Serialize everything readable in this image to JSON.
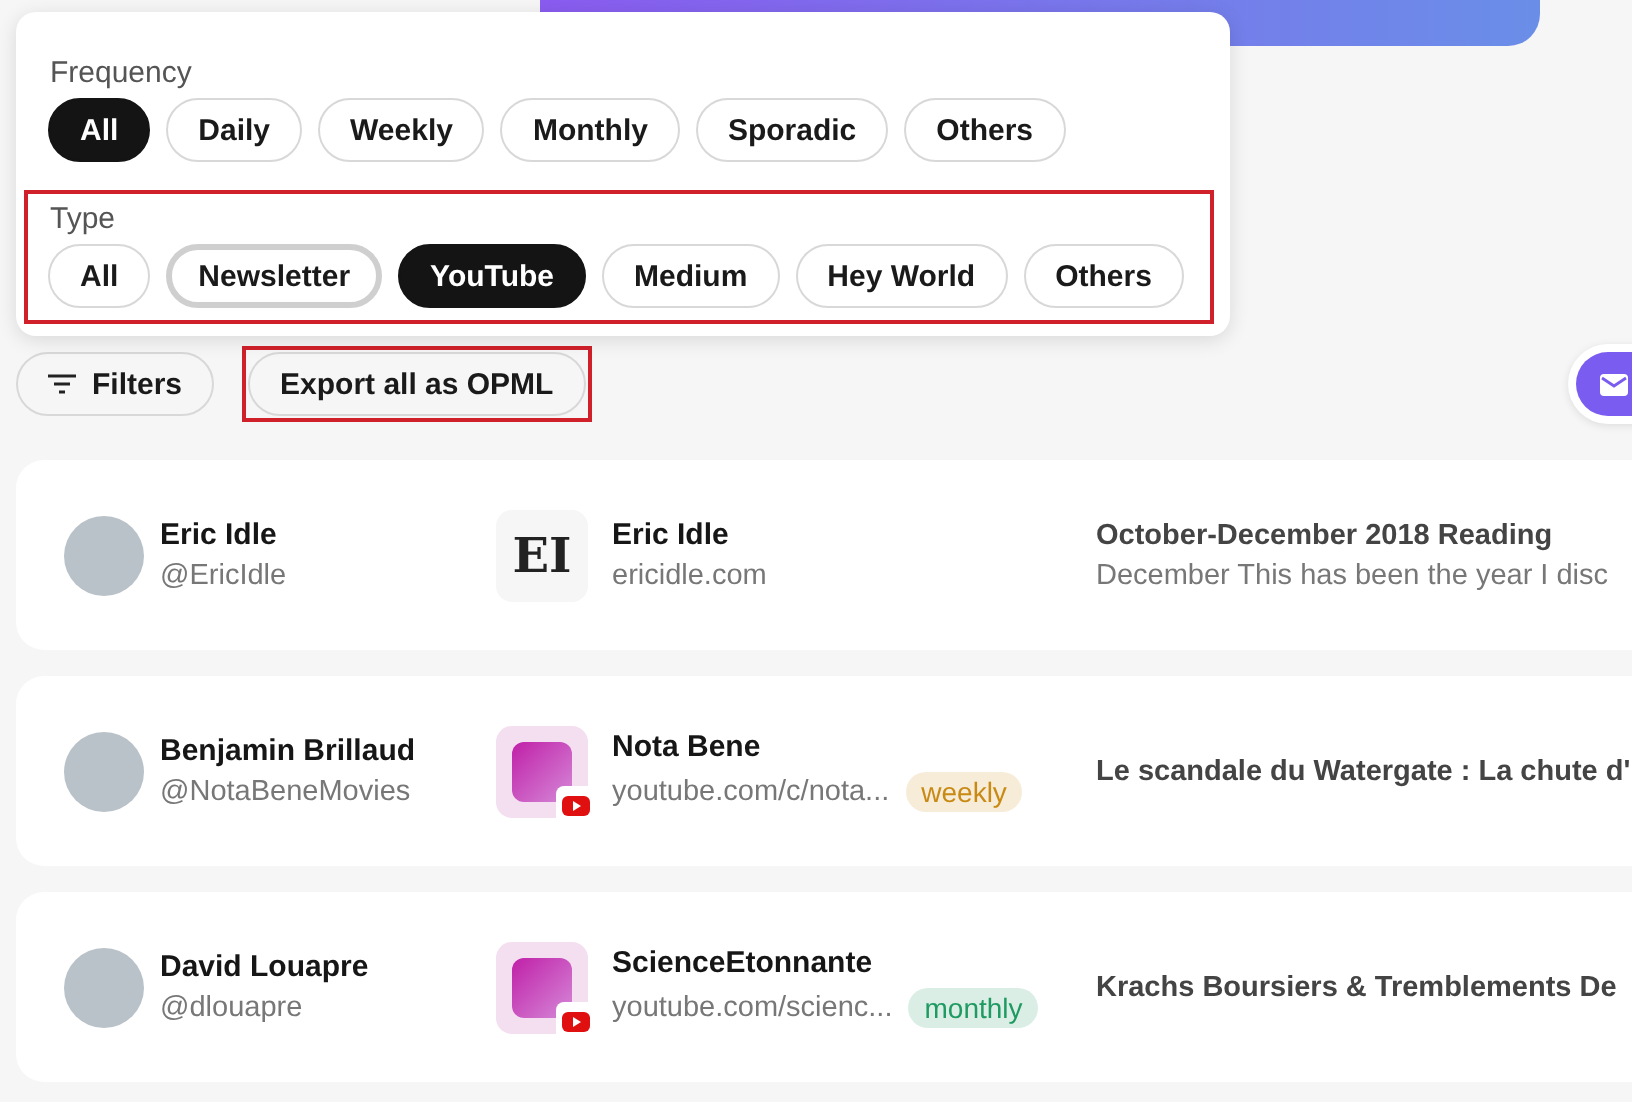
{
  "frequency_filter": {
    "label": "Frequency",
    "options": [
      {
        "label": "All",
        "selected": true,
        "focused": false
      },
      {
        "label": "Daily",
        "selected": false,
        "focused": false
      },
      {
        "label": "Weekly",
        "selected": false,
        "focused": false
      },
      {
        "label": "Monthly",
        "selected": false,
        "focused": false
      },
      {
        "label": "Sporadic",
        "selected": false,
        "focused": false
      },
      {
        "label": "Others",
        "selected": false,
        "focused": false
      }
    ]
  },
  "type_filter": {
    "label": "Type",
    "highlighted": true,
    "options": [
      {
        "label": "All",
        "selected": false,
        "focused": false
      },
      {
        "label": "Newsletter",
        "selected": false,
        "focused": true
      },
      {
        "label": "YouTube",
        "selected": true,
        "focused": false
      },
      {
        "label": "Medium",
        "selected": false,
        "focused": false
      },
      {
        "label": "Hey World",
        "selected": false,
        "focused": false
      },
      {
        "label": "Others",
        "selected": false,
        "focused": false
      }
    ]
  },
  "toolbar": {
    "filters_button": {
      "label": "Filters"
    },
    "export_button": {
      "label": "Export all as OPML",
      "highlighted": true
    }
  },
  "subscriptions": [
    {
      "name": "Eric Idle",
      "handle": "@EricIdle",
      "source": {
        "kind": "logo",
        "logo_text": "EI",
        "title": "Eric Idle",
        "url": "ericidle.com"
      },
      "post": {
        "title": "October-December 2018 Reading",
        "excerpt": "December This has been the year I disc"
      }
    },
    {
      "name": "Benjamin Brillaud",
      "handle": "@NotaBeneMovies",
      "source": {
        "kind": "youtube",
        "title": "Nota Bene",
        "url": "youtube.com/c/nota...",
        "frequency": {
          "label": "weekly",
          "color": "#c98a14"
        }
      },
      "post": {
        "title": "Le scandale du Watergate : La chute d'"
      }
    },
    {
      "name": "David Louapre",
      "handle": "@dlouapre",
      "source": {
        "kind": "youtube",
        "title": "ScienceEtonnante",
        "url": "youtube.com/scienc...",
        "frequency": {
          "label": "monthly",
          "color": "#1f9a62"
        }
      },
      "post": {
        "title": "Krachs Boursiers & Tremblements De"
      }
    }
  ]
}
